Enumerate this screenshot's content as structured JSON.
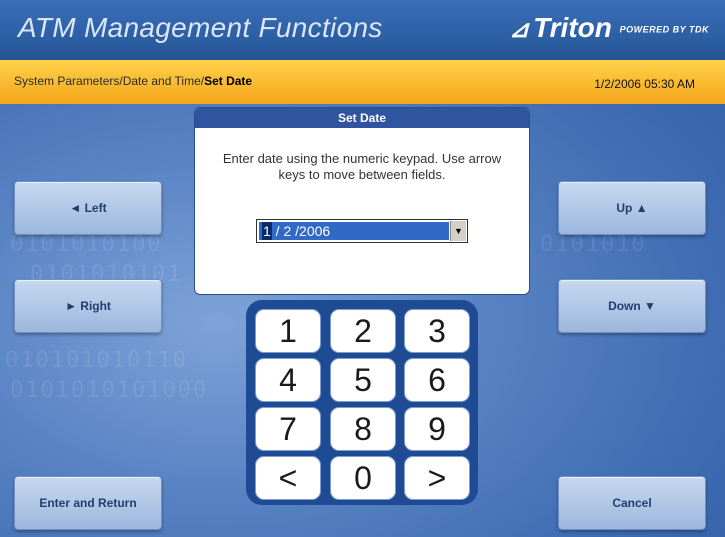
{
  "header": {
    "title": "ATM Management Functions",
    "logo_text": "Triton",
    "logo_suffix": "POWERED BY TDK"
  },
  "breadcrumb": {
    "path": "System Parameters/Date and Time/",
    "current": "Set Date"
  },
  "datetime": "1/2/2006  05:30 AM",
  "dialog": {
    "title": "Set Date",
    "instructions": "Enter date using the numeric keypad.  Use arrow keys to move between fields.",
    "date_value_active": "1",
    "date_value_rest": " / 2 /2006"
  },
  "buttons": {
    "left": "◄ Left",
    "right": "► Right",
    "up": "Up ▲",
    "down": "Down ▼",
    "enter_return": "Enter and Return",
    "cancel": "Cancel"
  },
  "keypad": [
    "1",
    "2",
    "3",
    "4",
    "5",
    "6",
    "7",
    "8",
    "9",
    "<",
    "0",
    ">"
  ],
  "colors": {
    "header_blue": "#245596",
    "crumb_yellow": "#f4a61a",
    "dialog_title": "#2f55a0",
    "keypad_frame": "#1f4b94"
  },
  "icons": {
    "dropdown": "chevron-down-icon",
    "logo_mark": "triangle-logo-icon"
  }
}
